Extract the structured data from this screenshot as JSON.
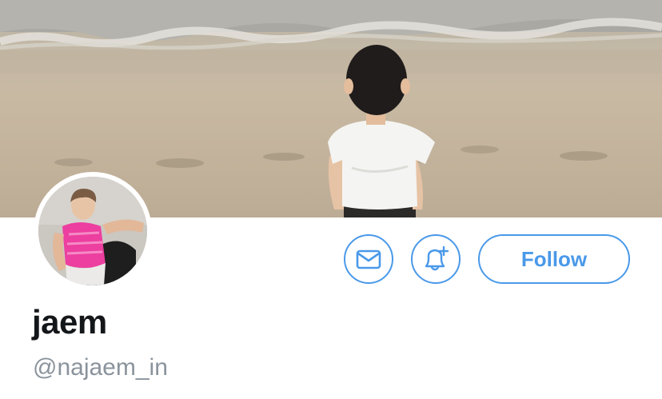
{
  "profile": {
    "display_name": "jaem",
    "handle": "@najaem_in"
  },
  "actions": {
    "follow_label": "Follow",
    "message_icon": "envelope-icon",
    "notify_icon": "bell-plus-icon"
  },
  "colors": {
    "accent": "#4a99e9",
    "name_text": "#14171a",
    "handle_text": "#8a939c"
  }
}
